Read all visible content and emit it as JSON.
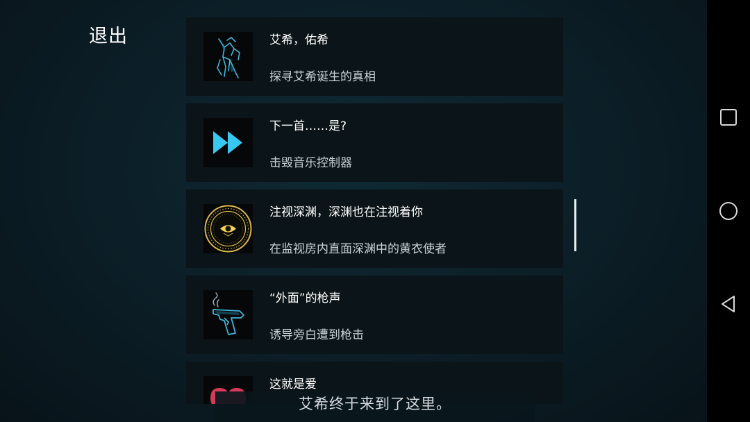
{
  "header": {
    "exit_label": "退出"
  },
  "achievements": [
    {
      "title": "艾希，佑希",
      "description": "探寻艾希诞生的真相",
      "icon": "winged-figure-icon"
    },
    {
      "title": "下一首……是?",
      "description": "击毁音乐控制器",
      "icon": "fast-forward-icon"
    },
    {
      "title": "注视深渊，深渊也在注视着你",
      "description": "在监视房内直面深渊中的黄衣使者",
      "icon": "golden-eye-icon"
    },
    {
      "title": "“外面”的枪声",
      "description": "诱导旁白遭到枪击",
      "icon": "smoking-pistol-icon"
    },
    {
      "title": "这就是爱",
      "description": "",
      "icon": "heart-icon"
    }
  ],
  "subtitle": "艾希终于来到了这里。",
  "nav": {
    "recent": "square-icon",
    "home": "circle-icon",
    "back": "triangle-back-icon"
  },
  "colors": {
    "background": "#0c1c24",
    "card": "#0b1418",
    "cyan_accent": "#36c8f0",
    "gold_accent": "#d8b84a",
    "heart": "#d63a5a"
  }
}
